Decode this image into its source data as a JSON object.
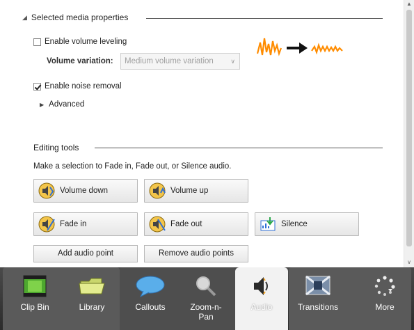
{
  "media_props": {
    "title": "Selected media properties",
    "volume_leveling": {
      "label": "Enable volume leveling",
      "checked": false
    },
    "volume_variation": {
      "label": "Volume variation:",
      "value": "Medium volume variation"
    },
    "noise_removal": {
      "label": "Enable noise removal",
      "checked": true
    },
    "advanced_label": "Advanced"
  },
  "editing_tools": {
    "title": "Editing tools",
    "hint": "Make a selection to Fade in, Fade out, or Silence audio.",
    "buttons": {
      "volume_down": "Volume down",
      "volume_up": "Volume up",
      "fade_in": "Fade in",
      "fade_out": "Fade out",
      "silence": "Silence",
      "add_point": "Add audio point",
      "remove_points": "Remove audio points"
    }
  },
  "tabs": [
    {
      "label": "Clip Bin",
      "icon": "film-strip-icon"
    },
    {
      "label": "Library",
      "icon": "folder-icon"
    },
    {
      "label": "Callouts",
      "icon": "speech-bubble-icon"
    },
    {
      "label": "Zoom-n-Pan",
      "icon": "magnifier-icon"
    },
    {
      "label": "Audio",
      "icon": "speaker-icon",
      "active": true
    },
    {
      "label": "Transitions",
      "icon": "transition-icon"
    },
    {
      "label": "More",
      "icon": "more-dots-icon"
    }
  ],
  "colors": {
    "accent_wave": "#ff8c00",
    "tabbar": "#3a3a3a",
    "active_tab": "#f2f2f2"
  }
}
